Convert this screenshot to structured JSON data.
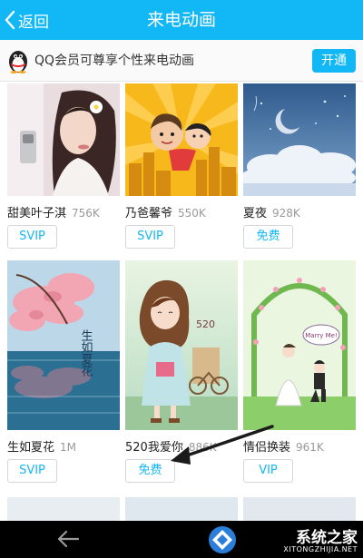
{
  "header": {
    "back_label": "返回",
    "title": "来电动画"
  },
  "vip_banner": {
    "text": "QQ会员可尊享个性来电动画",
    "button_label": "开通"
  },
  "items": [
    {
      "name": "甜美叶子淇",
      "size": "756K",
      "badge": "SVIP"
    },
    {
      "name": "乃爸馨爷",
      "size": "550K",
      "badge": "SVIP"
    },
    {
      "name": "夏夜",
      "size": "928K",
      "badge": "免费"
    },
    {
      "name": "生如夏花",
      "size": "1M",
      "badge": "SVIP"
    },
    {
      "name": "520我爱你",
      "size": "886K",
      "badge": "免费"
    },
    {
      "name": "情侣换装",
      "size": "961K",
      "badge": "VIP"
    }
  ],
  "thumb_text": {
    "summer_flower": "生如夏花",
    "number": "520",
    "marry": "Marry Me!"
  },
  "watermark": {
    "title": "系统之家",
    "site": "XITONGZHIJIA.NET"
  },
  "colors": {
    "accent": "#12b7f5",
    "arrow": "#1a1a1a"
  }
}
